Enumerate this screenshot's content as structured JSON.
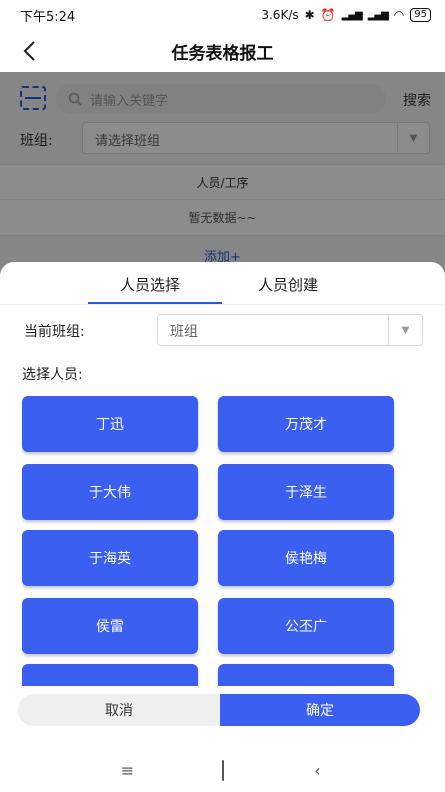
{
  "status_bar": {
    "time": "下午5:24",
    "speed": "3.6K/s",
    "signal_1": "HḎ̱lll",
    "signal_2": "HḎlll",
    "battery": "95"
  },
  "header": {
    "title": "任务表格报工",
    "back_icon": "‹"
  },
  "background": {
    "search_placeholder": "请输入关键字",
    "search_button": "搜索",
    "team_label": "班组:",
    "team_placeholder": "请选择班组",
    "table_header": "人员/工序",
    "table_empty": "暂无数据~~",
    "add_link": "添加+"
  },
  "sheet": {
    "tabs": [
      {
        "label": "人员选择",
        "active": true
      },
      {
        "label": "人员创建",
        "active": false
      }
    ],
    "current_team_label": "当前班组:",
    "current_team_value": "班组",
    "select_people_label": "选择人员:",
    "people": [
      "丁迅",
      "万茂才",
      "于大伟",
      "于泽生",
      "于海英",
      "侯艳梅",
      "侯雷",
      "公丕广",
      "",
      ""
    ],
    "cancel_label": "取消",
    "confirm_label": "确定"
  },
  "colors": {
    "accent": "#3b5ff0",
    "link": "#2a5bd7"
  },
  "nav": {
    "menu_icon": "≡",
    "back_icon": "‹"
  }
}
